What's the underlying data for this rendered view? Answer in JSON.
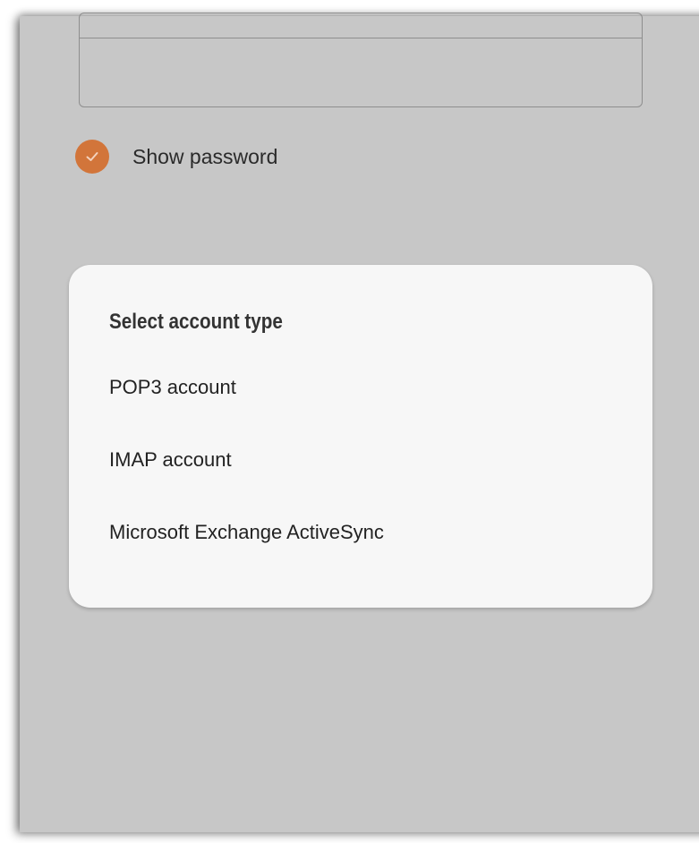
{
  "show_password": {
    "label": "Show password",
    "checked": true,
    "accent_color": "#d2753a",
    "icon": "checkmark-icon"
  },
  "dialog": {
    "title": "Select account type",
    "options": [
      {
        "label": "POP3 account"
      },
      {
        "label": "IMAP account"
      },
      {
        "label": "Microsoft Exchange ActiveSync"
      }
    ]
  }
}
